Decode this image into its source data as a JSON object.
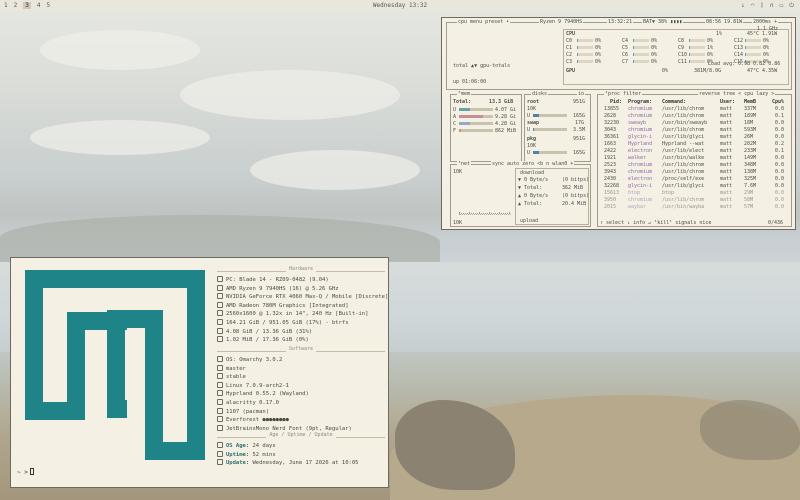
{
  "topbar": {
    "workspaces": [
      "1",
      "2",
      "3",
      "4",
      "5"
    ],
    "active_workspace": "3",
    "clock": "Wednesday 13:32",
    "tray_icons": [
      "download-icon",
      "wifi-icon",
      "bluetooth-icon",
      "headphones-icon",
      "battery-icon",
      "power-icon"
    ]
  },
  "btop": {
    "cpu_header": {
      "tabs": "cpu menu preset •",
      "model": "Ryzen 9 7940HS",
      "clock": "13:32:21",
      "battery": "BAT▼ 38% ▮▮▮▮",
      "uptime_clock": "08:56 19.81W",
      "refresh": "2000ms +"
    },
    "cpu_label": "CPU",
    "cpu_pct": "1%",
    "cpu_freq": "1.1 GHz",
    "cpu_temp": "45°C 1.91W",
    "cores": [
      {
        "name": "C0",
        "pct": "0%",
        "temp": "45°C"
      },
      {
        "name": "C1",
        "pct": "0%",
        "temp": "45°C"
      },
      {
        "name": "C2",
        "pct": "0%",
        "temp": "45°C"
      },
      {
        "name": "C3",
        "pct": "0%",
        "temp": "45°C"
      },
      {
        "name": "C4",
        "pct": "0%",
        "temp": "45°C"
      },
      {
        "name": "C5",
        "pct": "0%",
        "temp": "45°C"
      },
      {
        "name": "C6",
        "pct": "0%",
        "temp": "45°C"
      },
      {
        "name": "C7",
        "pct": "0%",
        "temp": "45°C"
      },
      {
        "name": "C8",
        "pct": "0%",
        "temp": "45°C"
      },
      {
        "name": "C9",
        "pct": "1%",
        "temp": "45°C"
      },
      {
        "name": "C10",
        "pct": "0%",
        "temp": "45°C"
      },
      {
        "name": "C11",
        "pct": "0%",
        "temp": "45°C"
      },
      {
        "name": "C12",
        "pct": "0%",
        "temp": "45°C"
      },
      {
        "name": "C13",
        "pct": "0%",
        "temp": "45°C"
      },
      {
        "name": "C14",
        "pct": "0%",
        "temp": "45°C"
      },
      {
        "name": "C15",
        "pct": "0%",
        "temp": "45°C"
      }
    ],
    "load_avg": "Load avg: 0.98 0.82 0.86",
    "gpu_label": "GPU",
    "gpu_pct": "0%",
    "gpu_mem": "381M/8.0G",
    "gpu_temp": "47°C 4.35W",
    "cpu_graph_label": "total ▲▼ gpu-totals",
    "uptime": "up 01:06:00",
    "mem": {
      "title": "²mem",
      "total_label": "Total:",
      "total": "13.3 GiB",
      "rows": [
        {
          "label": "U",
          "value": "4.07 Gi",
          "fill": 0.31,
          "color": "#6aa3a3"
        },
        {
          "label": "A",
          "value": "9.28 Gi",
          "fill": 0.7,
          "color": "#c88f99"
        },
        {
          "label": "C",
          "value": "4.28 Gi",
          "fill": 0.32,
          "color": "#9aa6c9"
        },
        {
          "label": "F",
          "value": "862 MiB",
          "fill": 0.06,
          "color": "#c2a15c"
        }
      ]
    },
    "disks": {
      "title": "disks",
      "io": "io",
      "root_label": "root",
      "root_size": "951G",
      "root_used": "10K",
      "root_u_label": "U",
      "root_u_val": "165G",
      "root_u_fill": 0.17,
      "swap_label": "swap",
      "swap_size": "17G",
      "swap_u_label": "U",
      "swap_u_val": "3.5M",
      "swap_u_fill": 0.01,
      "pkg_label": "pkg",
      "pkg_size": "951G",
      "pkg_used": "10K",
      "pkg_u_label": "U",
      "pkg_u_val": "165G",
      "pkg_u_fill": 0.17
    },
    "net": {
      "title": "³net",
      "tabs": "sync auto zero <b n wlan0 +",
      "scale": "10K",
      "scale_bottom": "10K",
      "download_label": "download",
      "upload_label": "upload",
      "rows": [
        {
          "label": "▼ 0 Byte/s",
          "value": "(0 bitps)"
        },
        {
          "label": "▼ Total:",
          "value": "362 MiB"
        },
        {
          "label": "▲ 0 Byte/s",
          "value": "(0 bitps)"
        },
        {
          "label": "▲ Total:",
          "value": "20.4 MiB"
        }
      ]
    },
    "proc": {
      "title": "⁴proc filter",
      "opts": "reverse tree < cpu lazy >",
      "headers": {
        "pid": "Pid:",
        "program": "Program:",
        "command": "Command:",
        "user": "User:",
        "mem": "MemB",
        "cpu": "Cpu%"
      },
      "rows": [
        {
          "pid": "13855",
          "program": "chromium",
          "command": "/usr/lib/chrom",
          "user": "matt",
          "mem": "337M",
          "cpu": "0.0",
          "fade": false
        },
        {
          "pid": "2628",
          "program": "chromium",
          "command": "/usr/lib/chrom",
          "user": "matt",
          "mem": "189M",
          "cpu": "0.1",
          "fade": false
        },
        {
          "pid": "32230",
          "program": "sweayb",
          "command": "/usr/bin/sweayb",
          "user": "matt",
          "mem": "18M",
          "cpu": "0.0",
          "fade": false
        },
        {
          "pid": "3043",
          "program": "chromium",
          "command": "/usr/lib/chrom",
          "user": "matt",
          "mem": "593M",
          "cpu": "0.0",
          "fade": false
        },
        {
          "pid": "36361",
          "program": "glycin-i",
          "command": "/usr/lib/glyci",
          "user": "matt",
          "mem": "26M",
          "cpu": "0.0",
          "fade": false
        },
        {
          "pid": "1663",
          "program": "Hyprland",
          "command": "Hyprland --wat",
          "user": "matt",
          "mem": "202M",
          "cpu": "0.2",
          "fade": false
        },
        {
          "pid": "2422",
          "program": "electron",
          "command": "/usr/lib/elect",
          "user": "matt",
          "mem": "233M",
          "cpu": "0.1",
          "fade": false
        },
        {
          "pid": "1921",
          "program": "walker",
          "command": "/usr/bin/walke",
          "user": "matt",
          "mem": "149M",
          "cpu": "0.0",
          "fade": false
        },
        {
          "pid": "2523",
          "program": "chromium",
          "command": "/usr/lib/chrom",
          "user": "matt",
          "mem": "348M",
          "cpu": "0.0",
          "fade": false
        },
        {
          "pid": "3943",
          "program": "chromium",
          "command": "/usr/lib/chrom",
          "user": "matt",
          "mem": "138M",
          "cpu": "0.0",
          "fade": false
        },
        {
          "pid": "2430",
          "program": "electron",
          "command": "/proc/self/exe",
          "user": "matt",
          "mem": "325M",
          "cpu": "0.0",
          "fade": false
        },
        {
          "pid": "32268",
          "program": "glycin-i",
          "command": "/usr/lib/glyci",
          "user": "matt",
          "mem": "7.6M",
          "cpu": "0.0",
          "fade": false
        },
        {
          "pid": "15613",
          "program": "btop",
          "command": "btop",
          "user": "matt",
          "mem": "29M",
          "cpu": "0.0",
          "fade": true
        },
        {
          "pid": "3950",
          "program": "chromium",
          "command": "/usr/lib/chrom",
          "user": "matt",
          "mem": "58M",
          "cpu": "0.0",
          "fade": true
        },
        {
          "pid": "2015",
          "program": "waybar",
          "command": "/usr/bin/wayba",
          "user": "matt",
          "mem": "57M",
          "cpu": "0.0",
          "fade": true
        }
      ],
      "footer": "↑ select ↓ info ↵ ¹kill¹ signals nice",
      "count": "0/436"
    }
  },
  "terminal": {
    "hardware_title": "Hardware",
    "hardware": [
      {
        "icon": "laptop-icon",
        "text": "PC: Blade 14 - RZ09-0482 (9.04)"
      },
      {
        "icon": "cpu-icon",
        "text": "AMD Ryzen 9 7940HS (16) @ 5.26 GHz"
      },
      {
        "icon": "gpu-icon",
        "text": "NVIDIA GeForce RTX 4060 Max-Q / Mobile [Discrete]"
      },
      {
        "icon": "gpu-icon",
        "text": "AMD Radeon 780M Graphics [Integrated]"
      },
      {
        "icon": "display-icon",
        "text": "2560x1600 @ 1.32x in 14\", 240 Hz [Built-in]"
      },
      {
        "icon": "disk-icon",
        "text": "164.21 GiB / 951.05 GiB (17%) - btrfs"
      },
      {
        "icon": "memory-icon",
        "text": "4.08 GiB / 13.36 GiB (31%)"
      },
      {
        "icon": "swap-icon",
        "text": "1.02 MiB / 17.36 GiB (0%)"
      }
    ],
    "software_title": "Software",
    "software": [
      {
        "icon": "os-icon",
        "text": "OS: Omarchy 3.0.2"
      },
      {
        "icon": "branch-icon",
        "text": "master"
      },
      {
        "icon": "channel-icon",
        "text": "stable"
      },
      {
        "icon": "kernel-icon",
        "text": "Linux 7.0.9-arch2-1"
      },
      {
        "icon": "wm-icon",
        "text": "Hyprland 0.55.2 (Wayland)"
      },
      {
        "icon": "terminal-icon",
        "text": "alacritty 0.17.0"
      },
      {
        "icon": "package-icon",
        "text": "1107 (pacman)"
      },
      {
        "icon": "palette-icon",
        "text": "Everforest ●●●●●●●●"
      },
      {
        "icon": "font-icon",
        "text": "JetBrainsMono Nerd Font (9pt, Regular)"
      }
    ],
    "age_title": "Age / Uptime / Update",
    "age": [
      {
        "icon": "calendar-icon",
        "key": "OS Age:",
        "text": "24 days"
      },
      {
        "icon": "clock-icon",
        "key": "Uptime:",
        "text": "52 mins"
      },
      {
        "icon": "update-icon",
        "key": "Update:",
        "text": "Wednesday, June 17 2026 at 10:05"
      }
    ],
    "prompt": "~ >",
    "logo_color": "#1f8487"
  }
}
